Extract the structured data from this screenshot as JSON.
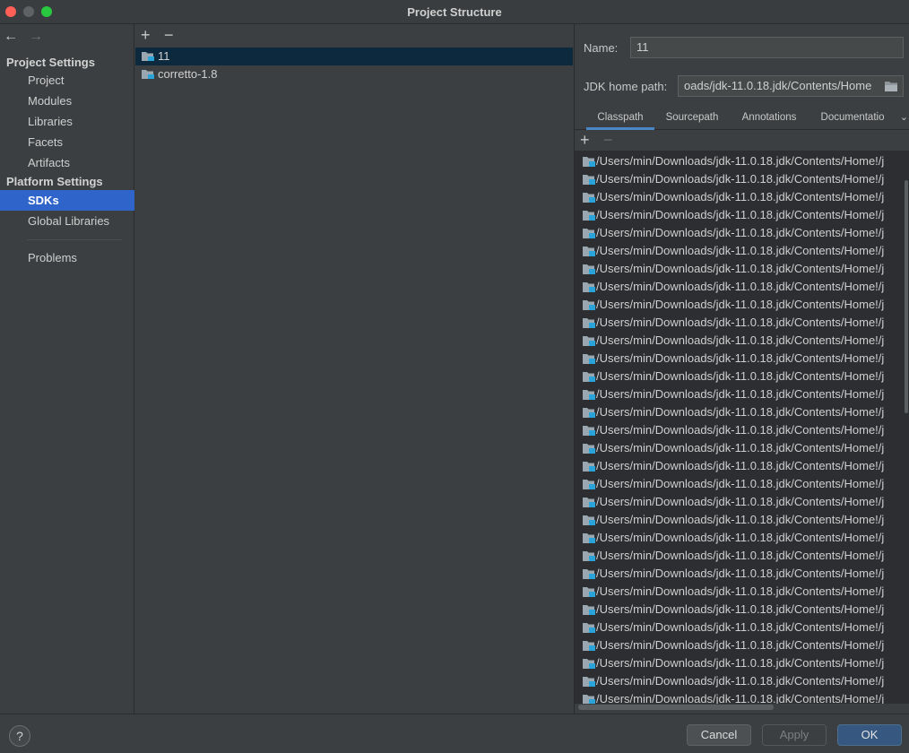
{
  "window": {
    "title": "Project Structure"
  },
  "nav": {
    "back_icon": "←",
    "forward_icon": "→"
  },
  "sidebar": {
    "project_settings_title": "Project Settings",
    "project_items": [
      {
        "label": "Project"
      },
      {
        "label": "Modules"
      },
      {
        "label": "Libraries"
      },
      {
        "label": "Facets"
      },
      {
        "label": "Artifacts"
      }
    ],
    "platform_settings_title": "Platform Settings",
    "platform_items": [
      {
        "label": "SDKs",
        "selected": true
      },
      {
        "label": "Global Libraries"
      }
    ],
    "problems_label": "Problems"
  },
  "sdk_toolbar": {
    "add": "+",
    "remove": "−"
  },
  "sdks": [
    {
      "name": "11",
      "selected": true
    },
    {
      "name": "corretto-1.8"
    }
  ],
  "details": {
    "name_label": "Name:",
    "name_value": "11",
    "jdk_home_label": "JDK home path:",
    "jdk_home_value": "oads/jdk-11.0.18.jdk/Contents/Home",
    "tabs": [
      {
        "label": "Classpath",
        "active": true
      },
      {
        "label": "Sourcepath"
      },
      {
        "label": "Annotations"
      },
      {
        "label": "Documentatio"
      }
    ],
    "classpath_toolbar": {
      "add": "+",
      "remove": "−"
    },
    "classpath_entry": "/Users/min/Downloads/jdk-11.0.18.jdk/Contents/Home!/j",
    "classpath_visible_rows": 31
  },
  "buttons": {
    "help": "?",
    "cancel": "Cancel",
    "apply": "Apply",
    "ok": "OK"
  },
  "colors": {
    "selection": "#2f65ca",
    "ok_button": "#365880",
    "icon_accent": "#2aa3d8"
  }
}
